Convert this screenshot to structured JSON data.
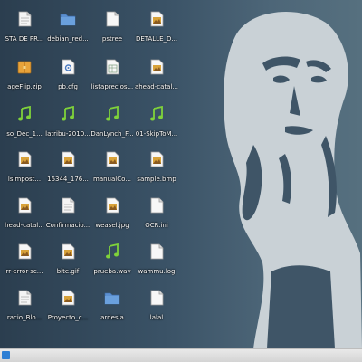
{
  "desktop": {
    "icons": [
      {
        "label": "STA DE PR...",
        "icon": "document-icon"
      },
      {
        "label": "debian_red...",
        "icon": "folder-icon"
      },
      {
        "label": "pstree",
        "icon": "text-file-icon"
      },
      {
        "label": "DETALLE_D...",
        "icon": "image-file-icon"
      },
      {
        "label": "ageFlip.zip",
        "icon": "archive-icon"
      },
      {
        "label": "pb.cfg",
        "icon": "config-file-icon"
      },
      {
        "label": "listaprecios...",
        "icon": "spreadsheet-icon"
      },
      {
        "label": "ahead-catal...",
        "icon": "image-file-icon"
      },
      {
        "label": "so_Dec_1...",
        "icon": "audio-file-icon"
      },
      {
        "label": "latribu-2010...",
        "icon": "audio-file-icon"
      },
      {
        "label": "DanLynch_F...",
        "icon": "audio-file-icon"
      },
      {
        "label": "01-SkipToM...",
        "icon": "audio-file-icon"
      },
      {
        "label": "lsimpost...",
        "icon": "image-file-icon"
      },
      {
        "label": "16344_176...",
        "icon": "image-file-icon"
      },
      {
        "label": "manualCo...",
        "icon": "image-file-icon"
      },
      {
        "label": "sample.bmp",
        "icon": "image-file-icon"
      },
      {
        "label": "head-catal...",
        "icon": "image-file-icon"
      },
      {
        "label": "Confirmacio...",
        "icon": "document-icon"
      },
      {
        "label": "weasel.jpg",
        "icon": "image-file-icon"
      },
      {
        "label": "OCR.ini",
        "icon": "text-file-icon"
      },
      {
        "label": "rr-error-sc...",
        "icon": "image-file-icon"
      },
      {
        "label": "bite.gif",
        "icon": "image-file-icon"
      },
      {
        "label": "prueba.wav",
        "icon": "audio-file-icon"
      },
      {
        "label": "wammu.log",
        "icon": "text-file-icon"
      },
      {
        "label": "racio_Blo...",
        "icon": "document-icon"
      },
      {
        "label": "Proyecto_c...",
        "icon": "image-file-icon"
      },
      {
        "label": "ardesia",
        "icon": "folder-icon"
      },
      {
        "label": "lalal",
        "icon": "text-file-icon"
      }
    ]
  },
  "colors": {
    "folder": "#5b8fd0",
    "audio": "#7fd23a",
    "image_accent": "#d8a23a",
    "archive": "#e8a33a"
  }
}
